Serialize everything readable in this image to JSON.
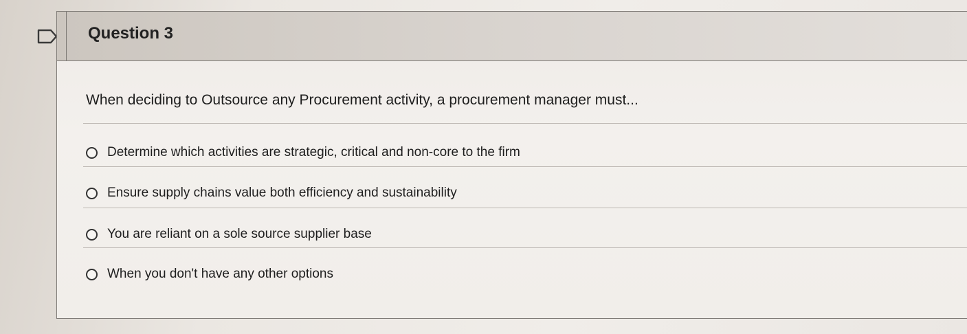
{
  "question": {
    "title": "Question 3",
    "prompt": "When deciding to Outsource any Procurement activity, a procurement manager must...",
    "options": [
      {
        "label": "Determine which activities are strategic, critical and non-core to the firm"
      },
      {
        "label": "Ensure supply chains value both efficiency and sustainability"
      },
      {
        "label": "You are reliant on a sole source supplier base"
      },
      {
        "label": "When you don't have any other options"
      }
    ]
  },
  "icons": {
    "flag": "flag-icon",
    "radio": "radio-unselected-icon"
  },
  "colors": {
    "header_bg": "#d3cdc6",
    "border": "#7e7a76",
    "text": "#1e1e1e"
  }
}
